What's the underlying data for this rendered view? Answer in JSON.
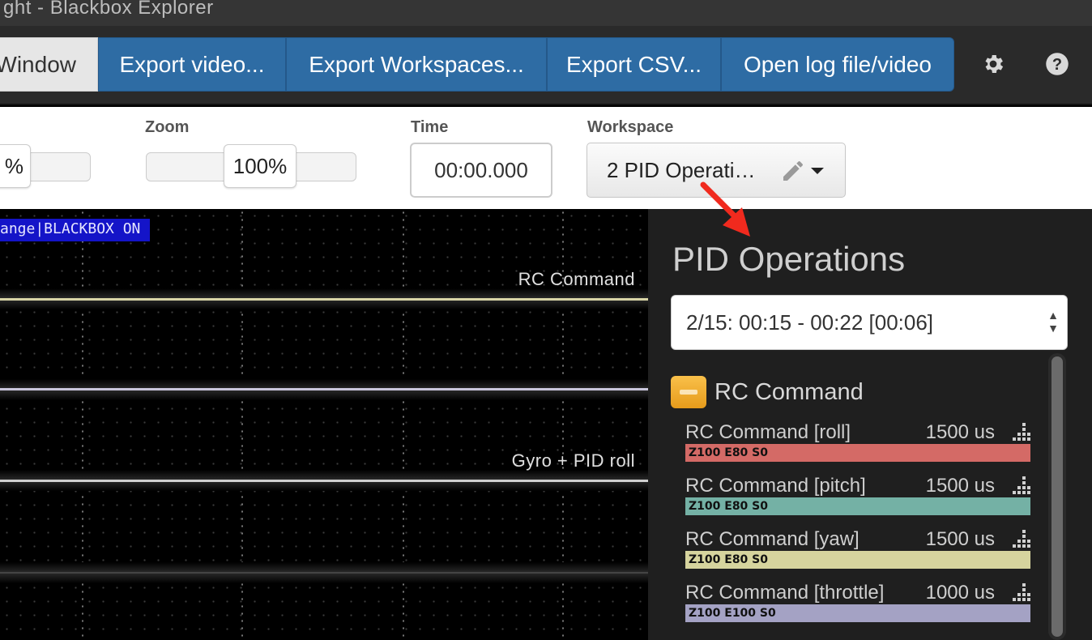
{
  "window": {
    "title": "ght - Blackbox Explorer"
  },
  "toolbar": {
    "buttons": [
      {
        "label": "Window"
      },
      {
        "label": "Export video..."
      },
      {
        "label": "Export Workspaces..."
      },
      {
        "label": "Export CSV..."
      },
      {
        "label": "Open log file/video"
      }
    ],
    "icons": [
      "gear-icon",
      "help-icon"
    ]
  },
  "controls": {
    "speed": {
      "value": "%"
    },
    "zoom": {
      "label": "Zoom",
      "value": "100%"
    },
    "time": {
      "label": "Time",
      "value": "00:00.000"
    },
    "workspace": {
      "label": "Workspace",
      "value": "2  PID Operati…"
    }
  },
  "graph": {
    "mode_badge": "ange|BLACKBOX ON",
    "titles": [
      "RC Command",
      "Gyro + PID roll"
    ],
    "colors": {
      "rc_trace": "#d8d4a6",
      "gyro_trace": "#c9c6dc"
    }
  },
  "panel": {
    "title": "PID Operations",
    "range": "2/15: 00:15 - 00:22 [00:06]",
    "group": {
      "label": "RC Command",
      "fields": [
        {
          "name": "RC Command [roll]",
          "value": "1500 us",
          "settings": "Z100 E80 S0",
          "color": "#d46a66"
        },
        {
          "name": "RC Command [pitch]",
          "value": "1500 us",
          "settings": "Z100 E80 S0",
          "color": "#74b1a5"
        },
        {
          "name": "RC Command [yaw]",
          "value": "1500 us",
          "settings": "Z100 E80 S0",
          "color": "#d6d49e"
        },
        {
          "name": "RC Command [throttle]",
          "value": "1000 us",
          "settings": "Z100 E100 S0",
          "color": "#a4a2c4"
        }
      ]
    }
  },
  "annotation": {
    "color": "#f02a1e"
  }
}
